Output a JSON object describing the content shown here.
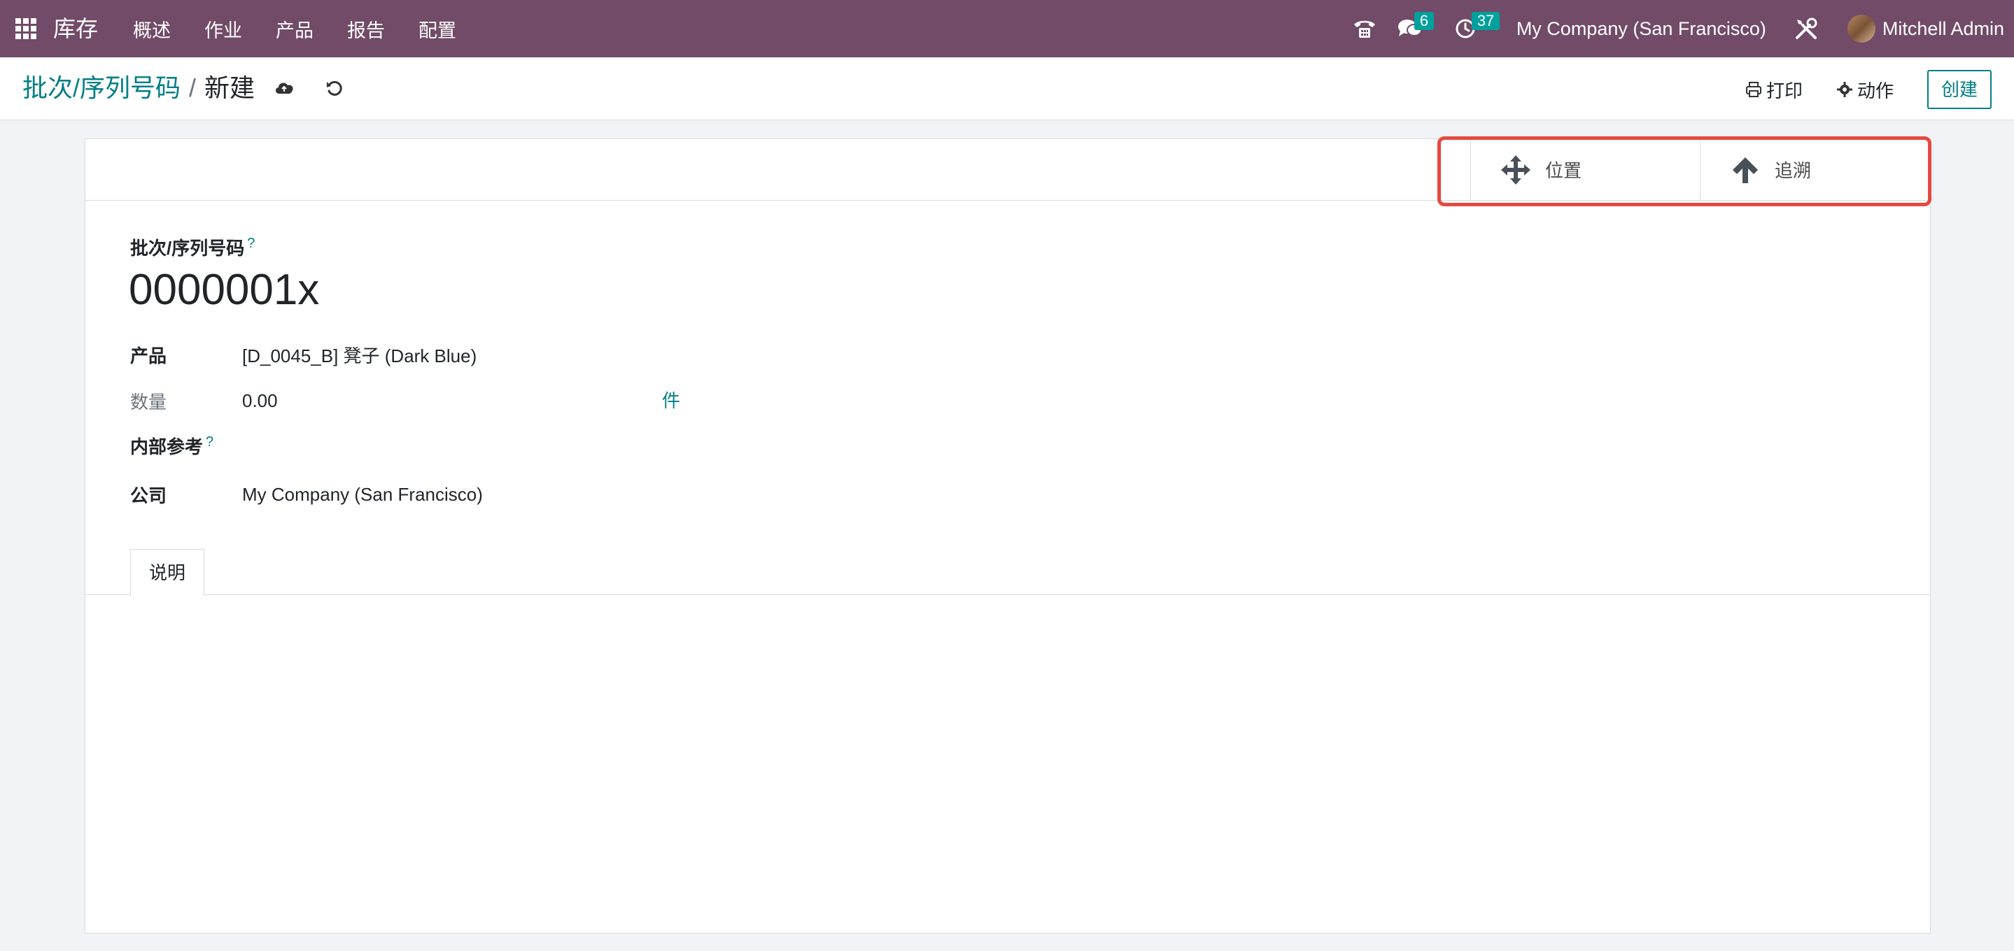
{
  "navbar": {
    "app_title": "库存",
    "menu": [
      "概述",
      "作业",
      "产品",
      "报告",
      "配置"
    ],
    "messages_count": "6",
    "activities_count": "37",
    "company": "My Company (San Francisco)",
    "user": "Mitchell Admin",
    "bg_color": "#714b67"
  },
  "control_panel": {
    "breadcrumb_parent": "批次/序列号码",
    "breadcrumb_sep": "/",
    "breadcrumb_current": "新建",
    "print_label": "打印",
    "action_label": "动作",
    "create_label": "创建",
    "accent_color": "#017e84"
  },
  "form": {
    "smart_buttons": [
      {
        "label": "位置",
        "icon": "move-arrows-icon"
      },
      {
        "label": "追溯",
        "icon": "arrow-up-icon"
      }
    ],
    "name_label": "批次/序列号码",
    "help_mark": "?",
    "name_value": "0000001x",
    "fields": {
      "product": {
        "label": "产品",
        "value": "[D_0045_B] 凳子 (Dark Blue)"
      },
      "quantity": {
        "label": "数量",
        "value": "0.00",
        "uom": "件"
      },
      "internal_ref": {
        "label": "内部参考",
        "value": ""
      },
      "company": {
        "label": "公司",
        "value": "My Company (San Francisco)"
      }
    },
    "tabs": [
      "说明"
    ]
  },
  "highlight_color": "#e5493f"
}
